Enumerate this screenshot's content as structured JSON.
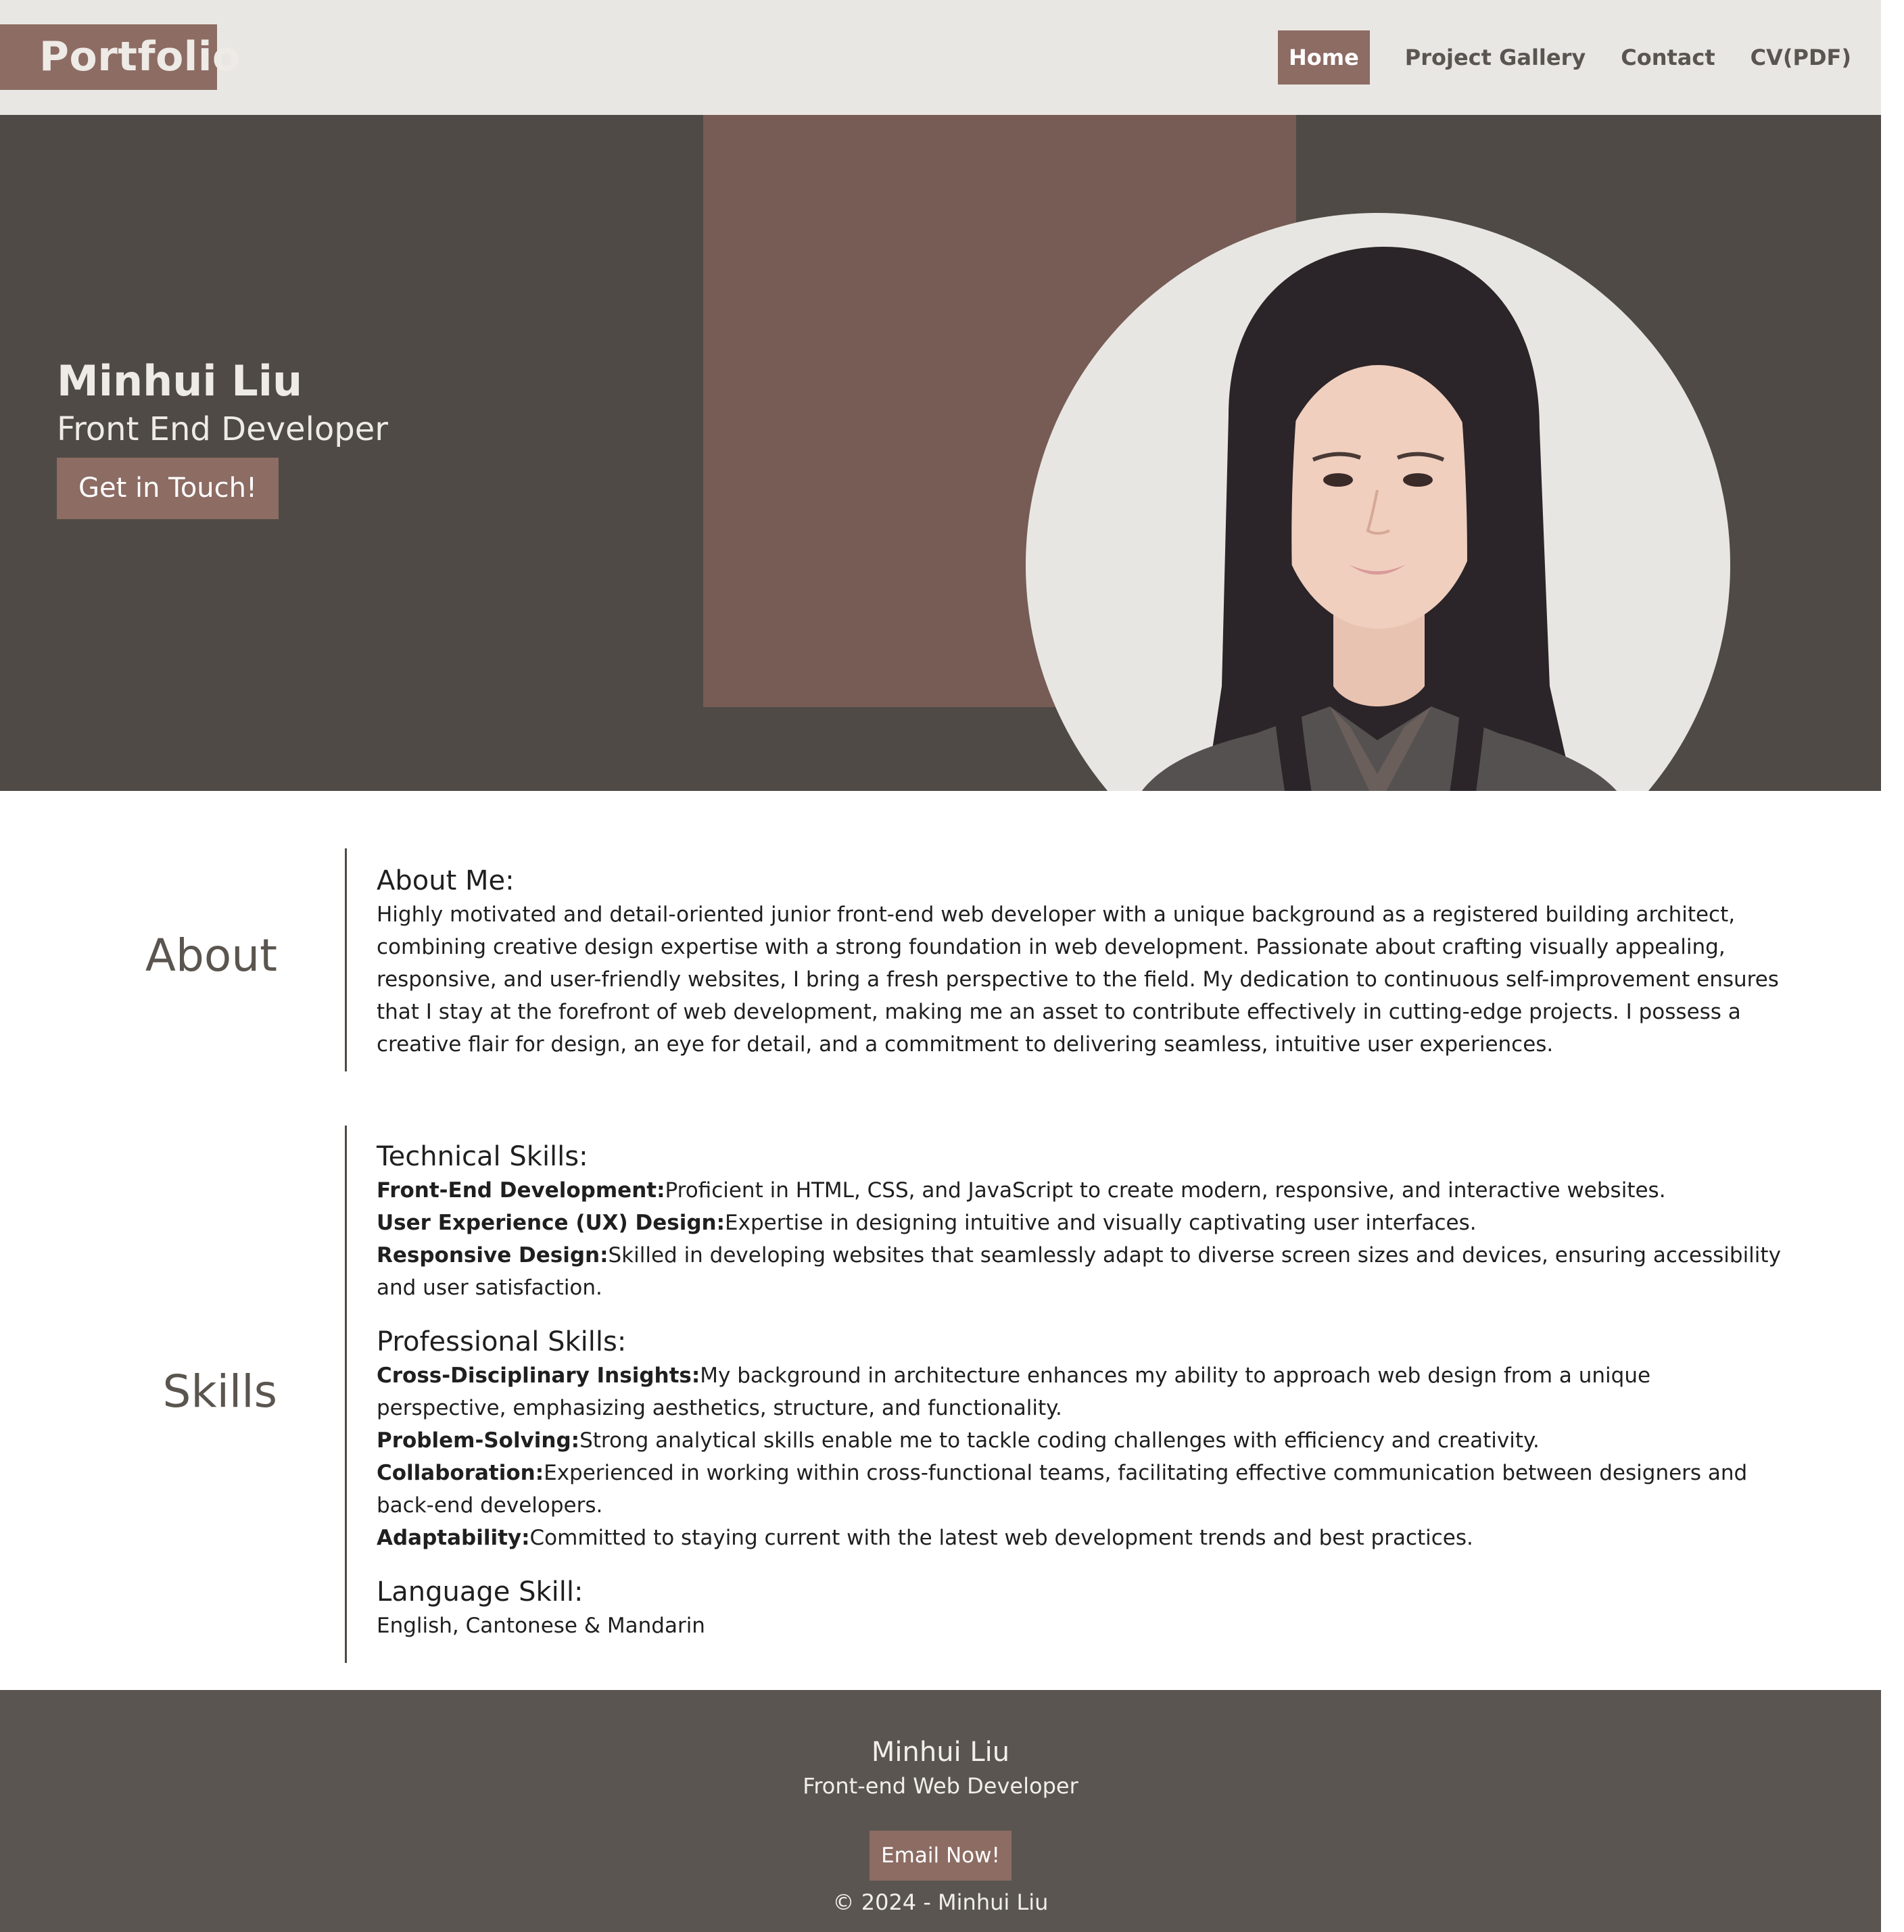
{
  "header": {
    "logo": "Portfolio",
    "nav": [
      "Home",
      "Project Gallery",
      "Contact",
      "CV(PDF)"
    ],
    "active_nav": "Home"
  },
  "hero": {
    "name": "Minhui Liu",
    "role": "Front End Developer",
    "cta": "Get in Touch!"
  },
  "about": {
    "label": "About",
    "title": "About Me:",
    "text": "Highly motivated and detail-oriented junior front-end web developer with a unique background as a registered building architect, combining creative design expertise with a strong foundation in web development. Passionate about crafting visually appealing, responsive, and user-friendly websites, I bring a fresh perspective to the field. My dedication to continuous self-improvement ensures that I stay at the forefront of web development, making me an asset to contribute effectively in cutting-edge projects. I possess a creative flair for design, an eye for detail, and a commitment to delivering seamless, intuitive user experiences."
  },
  "skills": {
    "label": "Skills",
    "technical": {
      "title": "Technical Skills:",
      "items": [
        {
          "term": "Front-End Development:",
          "desc": "Proficient in HTML, CSS, and JavaScript to create modern, responsive, and interactive websites."
        },
        {
          "term": "User Experience (UX) Design:",
          "desc": "Expertise in designing intuitive and visually captivating user interfaces."
        },
        {
          "term": "Responsive Design:",
          "desc": "Skilled in developing websites that seamlessly adapt to diverse screen sizes and devices, ensuring accessibility and user satisfaction."
        }
      ]
    },
    "professional": {
      "title": "Professional Skills:",
      "items": [
        {
          "term": "Cross-Disciplinary Insights:",
          "desc": "My background in architecture enhances my ability to approach web design from a unique perspective, emphasizing aesthetics, structure, and functionality."
        },
        {
          "term": "Problem-Solving:",
          "desc": "Strong analytical skills enable me to tackle coding challenges with efficiency and creativity."
        },
        {
          "term": "Collaboration:",
          "desc": "Experienced in working within cross-functional teams, facilitating effective communication between designers and back-end developers."
        },
        {
          "term": "Adaptability:",
          "desc": "Committed to staying current with the latest web development trends and best practices."
        }
      ]
    },
    "language": {
      "title": "Language Skill:",
      "text": "English, Cantonese & Mandarin"
    }
  },
  "footer": {
    "name": "Minhui Liu",
    "role": "Front-end Web Developer",
    "button": "Email Now!",
    "copyright": "© 2024 - Minhui Liu"
  },
  "colors": {
    "header_bg": "#e9e7e3",
    "accent": "#8c6c63",
    "hero_bg": "#4f4a45",
    "hero_block": "#765c55",
    "footer_bg": "#5a5550"
  }
}
